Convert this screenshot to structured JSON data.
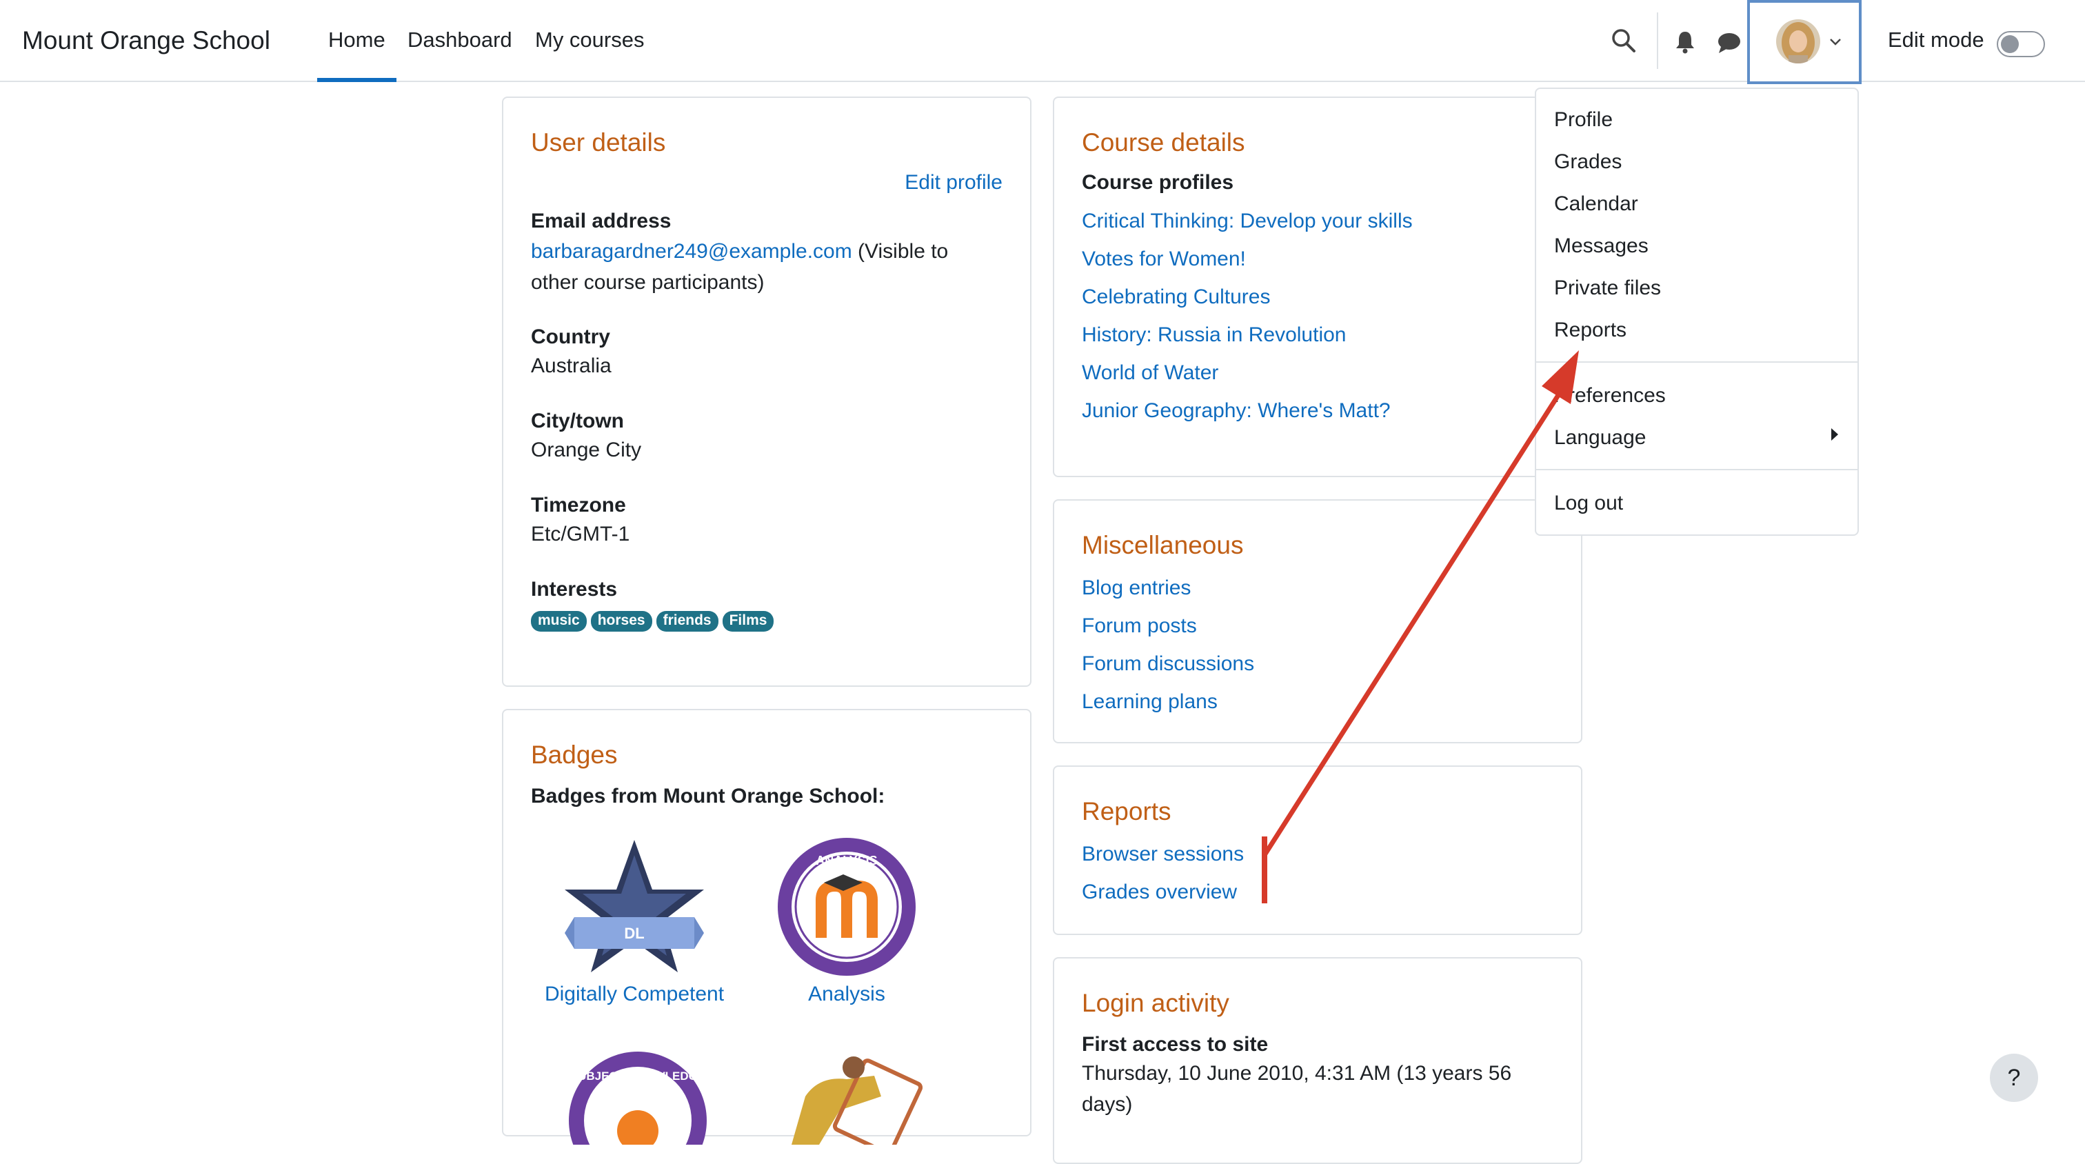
{
  "header": {
    "site_name": "Mount Orange School",
    "nav": [
      "Home",
      "Dashboard",
      "My courses"
    ],
    "active_nav": "Home",
    "edit_mode_label": "Edit mode",
    "edit_mode_on": false
  },
  "user_menu": {
    "items": [
      "Profile",
      "Grades",
      "Calendar",
      "Messages",
      "Private files",
      "Reports"
    ],
    "items2": [
      "Preferences",
      "Language"
    ],
    "items3": [
      "Log out"
    ]
  },
  "user_details": {
    "title": "User details",
    "edit_profile": "Edit profile",
    "email_label": "Email address",
    "email": "barbaragardner249@example.com",
    "email_note": " (Visible to",
    "email_note2": "other course participants)",
    "country_label": "Country",
    "country": "Australia",
    "city_label": "City/town",
    "city": "Orange City",
    "timezone_label": "Timezone",
    "timezone": "Etc/GMT-1",
    "interests_label": "Interests",
    "interests": [
      "music",
      "horses",
      "friends",
      "Films"
    ]
  },
  "badges": {
    "title": "Badges",
    "subtitle": "Badges from Mount Orange School:",
    "items": [
      "Digitally Competent",
      "Analysis"
    ],
    "star_text": "DL",
    "analysis_text": "ANALYSIS",
    "subject_text": "SUBJECT KNOWLEDGE"
  },
  "course_details": {
    "title": "Course details",
    "profiles_label": "Course profiles",
    "courses": [
      "Critical Thinking: Develop your skills",
      "Votes for Women!",
      "Celebrating Cultures",
      "History: Russia in Revolution",
      "World of Water",
      "Junior Geography: Where's Matt?"
    ]
  },
  "misc": {
    "title": "Miscellaneous",
    "links": [
      "Blog entries",
      "Forum posts",
      "Forum discussions",
      "Learning plans"
    ]
  },
  "reports": {
    "title": "Reports",
    "links": [
      "Browser sessions",
      "Grades overview"
    ]
  },
  "login_activity": {
    "title": "Login activity",
    "first_access_label": "First access to site",
    "first_access": "Thursday, 10 June 2010, 4:31 AM  (13 years 56",
    "first_access_cont": "days)"
  },
  "help_label": "?",
  "colors": {
    "accent": "#0f6cbf",
    "card_title": "#c05f16",
    "tag": "#1f7287",
    "annotation_arrow": "#d63a2a"
  }
}
